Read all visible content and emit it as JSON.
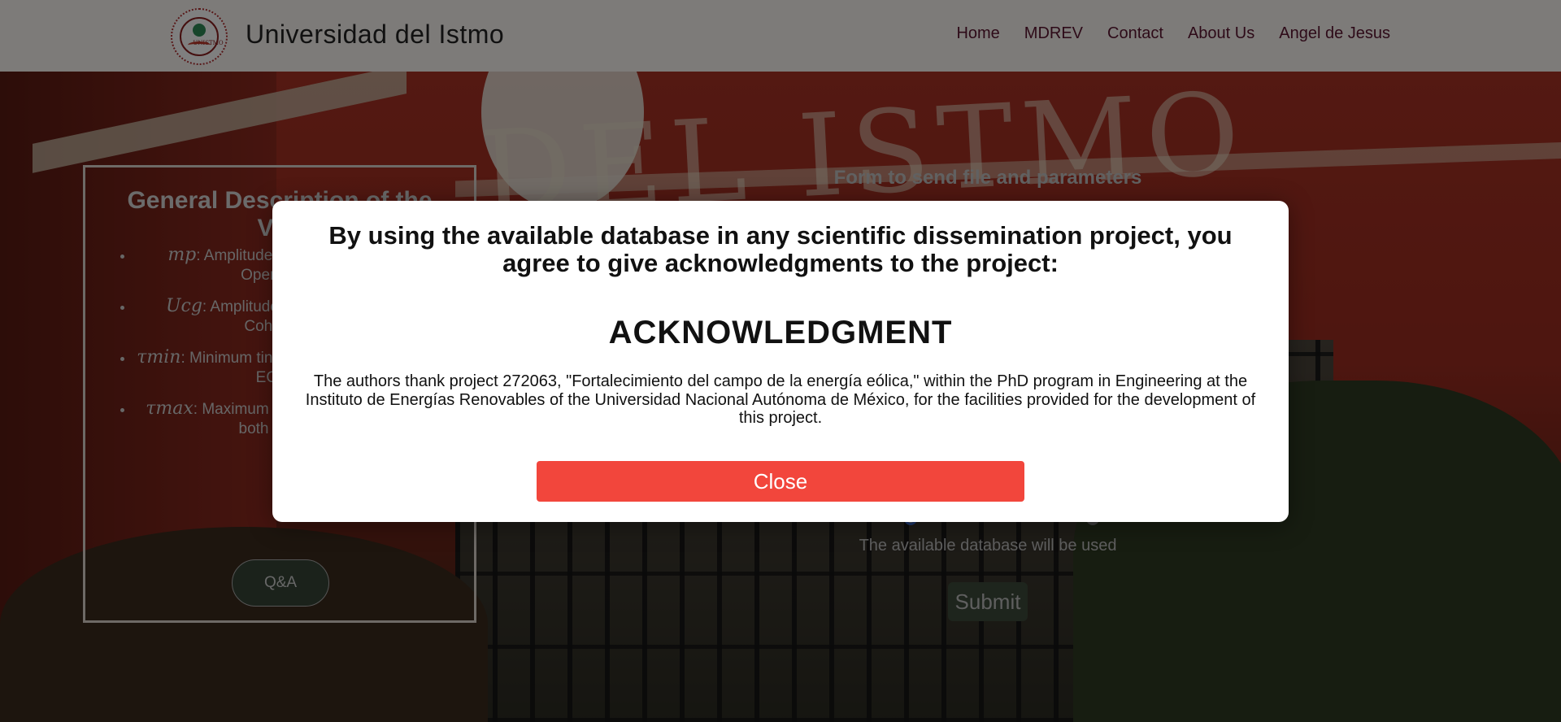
{
  "header": {
    "logo_text": "UNISTMO",
    "title": "Universidad del Istmo",
    "nav": [
      {
        "label": "Home"
      },
      {
        "label": "MDREV"
      },
      {
        "label": "Contact"
      },
      {
        "label": "About Us"
      },
      {
        "label": "Angel de Jesus"
      }
    ]
  },
  "description_panel": {
    "title": "General Description of the Vari",
    "items": [
      {
        "symbol": "mp",
        "text": ": Amplitude th exceeded to ident Operational Ex"
      },
      {
        "symbol": "Ucg",
        "text": ": Amplitude th exceeded to iden Coherent Extr"
      },
      {
        "symbol": "τmin",
        "text": ": Minimum tin interval in which t of both EOGs and"
      },
      {
        "symbol": "τmax",
        "text": ": Maximum tin interval in which th of both EOGs and"
      }
    ],
    "qa_label": "Q&A"
  },
  "form": {
    "title": "Form to send file and parameters",
    "radio_note": "The available database will be used",
    "submit_label": "Submit"
  },
  "modal": {
    "heading": "By using the available database in any scientific dissemination project, you agree to give acknowledgments to the project:",
    "subheading": "ACKNOWLEDGMENT",
    "body": "The authors thank project 272063, \"Fortalecimiento del campo de la energía eólica,\" within the PhD program in Engineering at the Instituto de Energías Renovables of the Universidad Nacional Autónoma de México, for the facilities provided for the development of this project.",
    "close_label": "Close"
  },
  "colors": {
    "header_bg": "#fbf7f2",
    "nav_text": "#5b1530",
    "close_button": "#f2463c",
    "submit_button": "#3c4a3a"
  }
}
